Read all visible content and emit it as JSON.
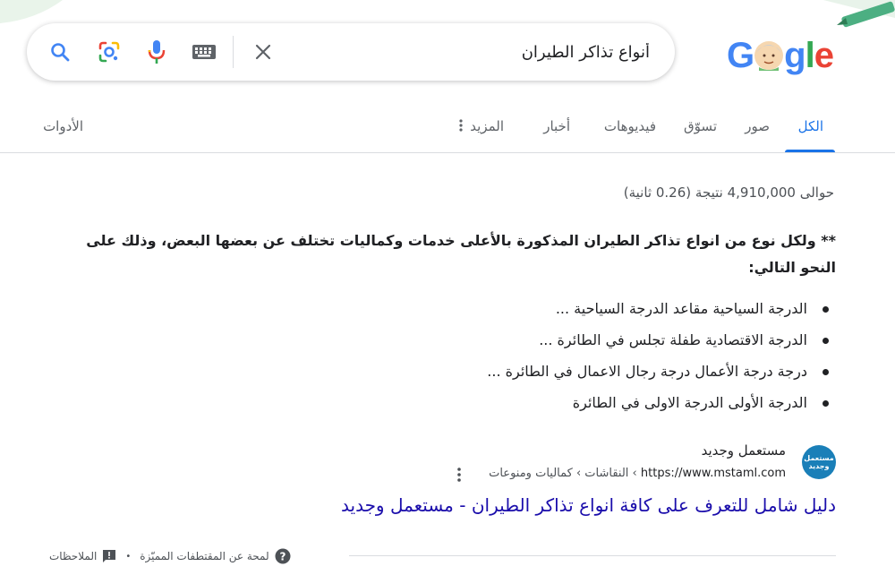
{
  "search": {
    "query": "أنواع تذاكر الطيران"
  },
  "tabs": [
    {
      "label": "الكل"
    },
    {
      "label": "صور"
    },
    {
      "label": "تسوّق"
    },
    {
      "label": "فيديوهات"
    },
    {
      "label": "أخبار"
    },
    {
      "label": "المزيد"
    }
  ],
  "tools_label": "الأدوات",
  "results_stats": "حوالى 4,910,000 نتيجة (0.26 ثانية)",
  "snippet": {
    "heading": "** ولكل نوع من انواع تذاكر الطيران المذكورة بالأعلى خدمات وكماليات تختلف عن بعضها البعض، وذلك على النحو التالي:",
    "items": [
      "الدرجة السياحية مقاعد الدرجة السياحية ...",
      "الدرجة الاقتصادية طفلة تجلس في الطائرة ...",
      "درجة درجة الأعمال درجة رجال الاعمال في الطائرة ...",
      "الدرجة الأولى الدرجة الاولى في الطائرة"
    ]
  },
  "source": {
    "favicon_text": "مستعمل وجديد",
    "name": "مستعمل وجديد",
    "url_domain": "https://www.mstaml.com",
    "url_path": " › النقاشات › كماليات ومنوعات",
    "title": "دليل شامل للتعرف على كافة انواع تذاكر الطيران - مستعمل وجديد"
  },
  "footer": {
    "about_label": "لمحة عن المقتطفات المميّزة",
    "separator": "•",
    "feedback_label": "الملاحظات"
  },
  "colors": {
    "accent": "#1a73e8",
    "link": "#1a0dab",
    "text": "#202124",
    "muted": "#5f6368"
  }
}
